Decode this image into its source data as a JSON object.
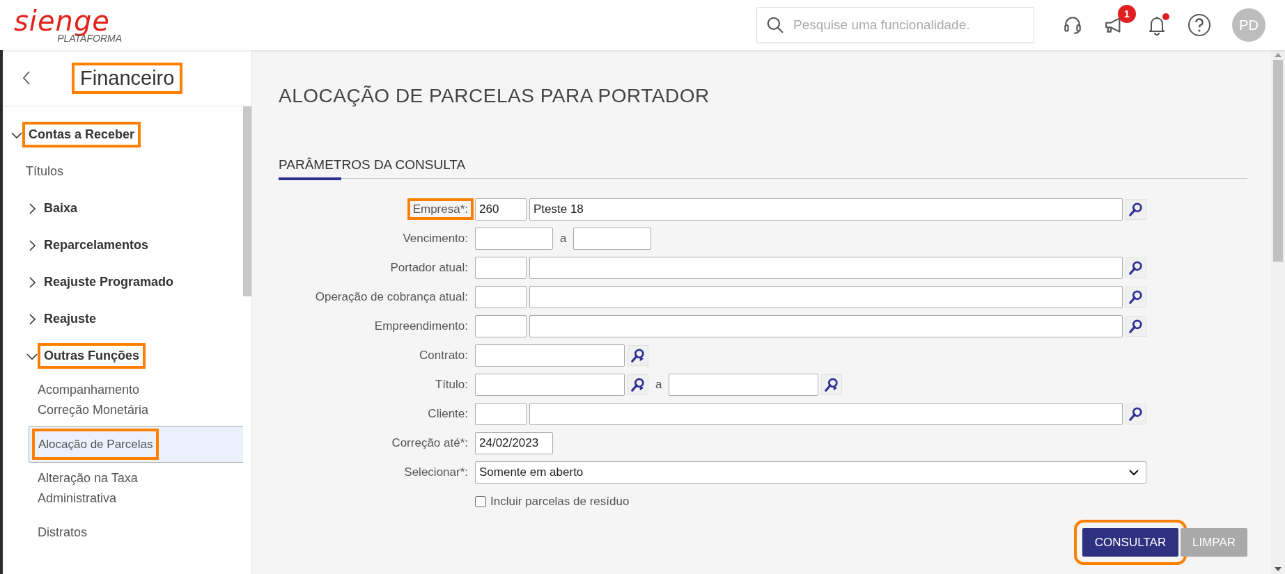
{
  "header": {
    "logo": {
      "brand": "sienge",
      "subtitle": "PLATAFORMA"
    },
    "search": {
      "placeholder": "Pesquise uma funcionalidade."
    },
    "announcements_badge": "1",
    "bell_unread": true,
    "avatar": "PD"
  },
  "sidebar": {
    "title": "Financeiro",
    "title_highlighted": true,
    "items": [
      {
        "label": "Contas a Receber",
        "kind": "group",
        "expanded": true,
        "highlighted": true,
        "children": [
          {
            "label": "Títulos",
            "kind": "link",
            "selected": false,
            "highlighted": false
          },
          {
            "label": "Baixa",
            "kind": "group",
            "expanded": false,
            "highlighted": false
          },
          {
            "label": "Reparcelamentos",
            "kind": "group",
            "expanded": false,
            "highlighted": false
          },
          {
            "label": "Reajuste Programado",
            "kind": "group",
            "expanded": false,
            "highlighted": false
          },
          {
            "label": "Reajuste",
            "kind": "group",
            "expanded": false,
            "highlighted": false
          },
          {
            "label": "Outras Funções",
            "kind": "group",
            "expanded": true,
            "highlighted": true,
            "children": [
              {
                "label": "Acompanhamento Correção Monetária",
                "kind": "link",
                "selected": false,
                "highlighted": false
              },
              {
                "label": "Alocação de Parcelas",
                "kind": "link",
                "selected": true,
                "highlighted": true
              },
              {
                "label": "Alteração na Taxa Administrativa",
                "kind": "link",
                "selected": false,
                "highlighted": false
              },
              {
                "label": "Distratos",
                "kind": "link",
                "selected": false,
                "highlighted": false
              }
            ]
          }
        ]
      }
    ]
  },
  "page": {
    "title": "ALOCAÇÃO DE PARCELAS PARA PORTADOR",
    "section": "PARÂMETROS DA CONSULTA"
  },
  "form": [
    {
      "kind": "code_name",
      "label": "Empresa*:",
      "highlighted": true,
      "code": "260",
      "name": "Pteste 18"
    },
    {
      "kind": "range",
      "label": "Vencimento:",
      "highlighted": false,
      "separator": "a"
    },
    {
      "kind": "code_name",
      "label": "Portador atual:",
      "highlighted": false
    },
    {
      "kind": "code_name",
      "label": "Operação de cobrança atual:",
      "highlighted": false
    },
    {
      "kind": "code_name",
      "label": "Empreendimento:",
      "highlighted": false
    },
    {
      "kind": "text_lookup",
      "label": "Contrato:",
      "highlighted": false
    },
    {
      "kind": "range_lookup",
      "label": "Título:",
      "highlighted": false,
      "separator": "a"
    },
    {
      "kind": "code_name",
      "label": "Cliente:",
      "highlighted": false
    },
    {
      "kind": "date",
      "label": "Correção até*:",
      "highlighted": false,
      "value": "24/02/2023"
    },
    {
      "kind": "select",
      "label": "Selecionar*:",
      "highlighted": false,
      "value": "Somente em aberto"
    },
    {
      "kind": "checkbox",
      "label": "Incluir parcelas de resíduo",
      "checked": false
    }
  ],
  "buttons": [
    {
      "label": "CONSULTAR",
      "kind": "primary",
      "highlighted": true
    },
    {
      "label": "LIMPAR",
      "kind": "secondary",
      "highlighted": false
    }
  ]
}
